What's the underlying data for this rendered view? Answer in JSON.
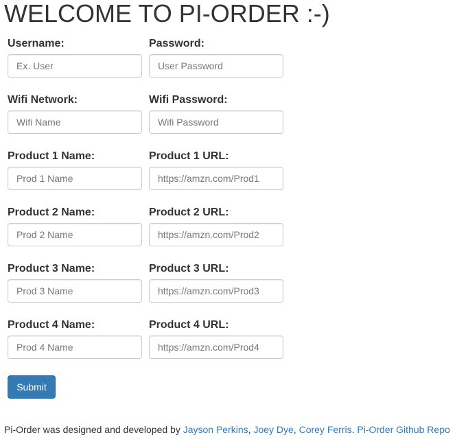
{
  "page": {
    "title": "WELCOME TO PI-ORDER :-)"
  },
  "form": {
    "rows": [
      {
        "left": {
          "label": "Username:",
          "placeholder": "Ex. User"
        },
        "right": {
          "label": "Password:",
          "placeholder": "User Password"
        }
      },
      {
        "left": {
          "label": "Wifi Network:",
          "placeholder": "Wifi Name"
        },
        "right": {
          "label": "Wifi Password:",
          "placeholder": "Wifi Password"
        }
      },
      {
        "left": {
          "label": "Product 1 Name:",
          "placeholder": "Prod 1 Name"
        },
        "right": {
          "label": "Product 1 URL:",
          "placeholder": "https://amzn.com/Prod1"
        }
      },
      {
        "left": {
          "label": "Product 2 Name:",
          "placeholder": "Prod 2 Name"
        },
        "right": {
          "label": "Product 2 URL:",
          "placeholder": "https://amzn.com/Prod2"
        }
      },
      {
        "left": {
          "label": "Product 3 Name:",
          "placeholder": "Prod 3 Name"
        },
        "right": {
          "label": "Product 3 URL:",
          "placeholder": "https://amzn.com/Prod3"
        }
      },
      {
        "left": {
          "label": "Product 4 Name:",
          "placeholder": "Prod 4 Name"
        },
        "right": {
          "label": "Product 4 URL:",
          "placeholder": "https://amzn.com/Prod4"
        }
      }
    ],
    "submit_label": "Submit"
  },
  "footer": {
    "prefix": "Pi-Order was designed and developed by ",
    "authors": [
      "Jayson Perkins",
      "Joey Dye",
      "Corey Ferris"
    ],
    "sep1": ", ",
    "sep2": ", ",
    "sep3": ". ",
    "repo_link": "Pi-Order Github Repo"
  },
  "colors": {
    "link": "#337ab7",
    "primary_button": "#337ab7",
    "text": "#333333"
  }
}
